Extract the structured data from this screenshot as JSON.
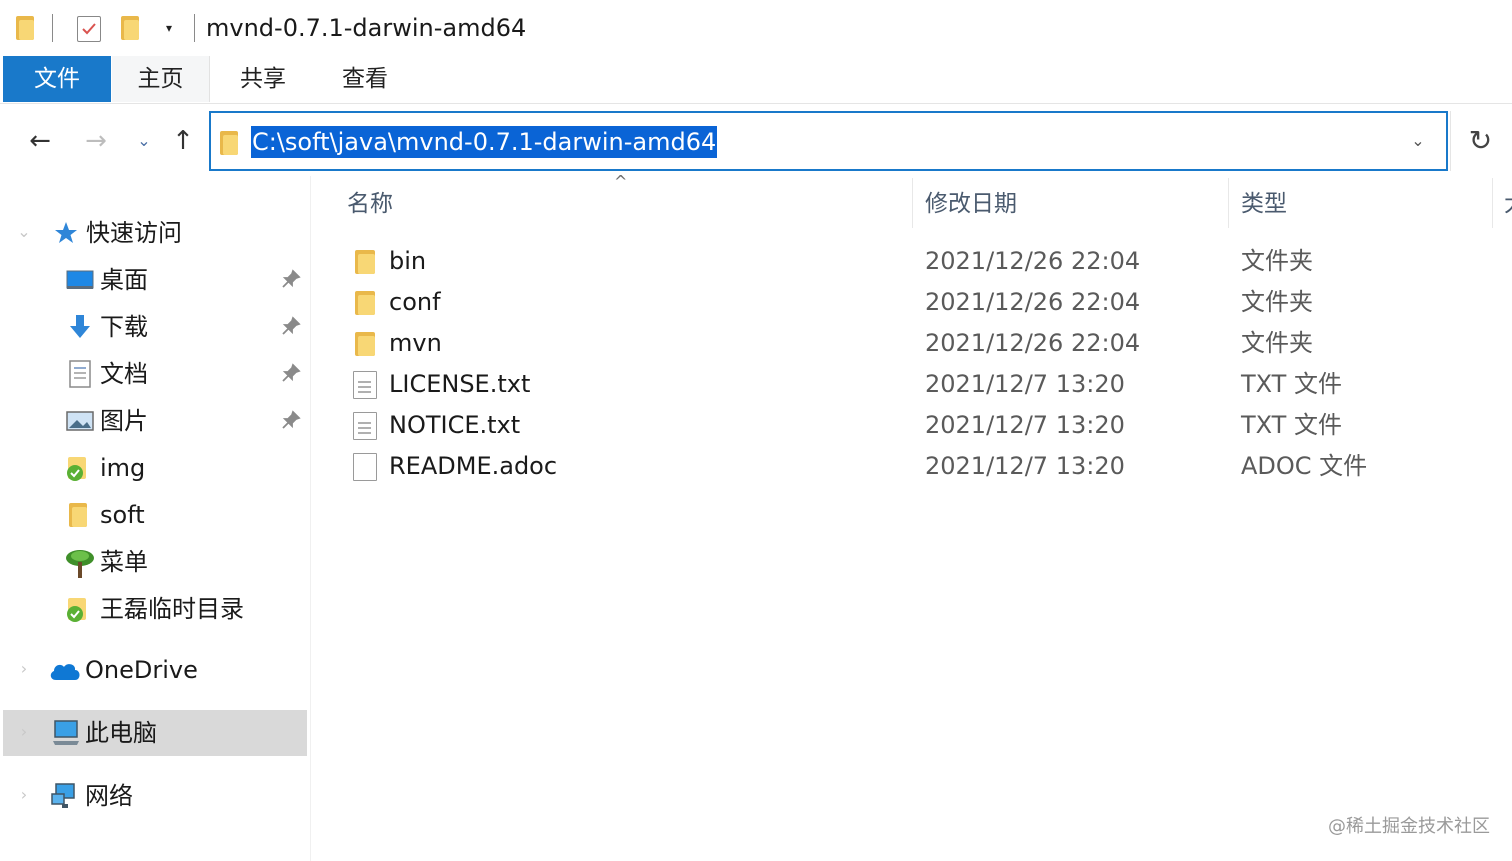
{
  "window": {
    "title": "mvnd-0.7.1-darwin-amd64"
  },
  "quick_access_toolbar": {
    "dropdown": "▾"
  },
  "ribbon": {
    "tabs": [
      {
        "label": "文件",
        "active": true
      },
      {
        "label": "主页"
      },
      {
        "label": "共享"
      },
      {
        "label": "查看"
      }
    ]
  },
  "nav": {
    "back": "←",
    "forward": "→",
    "recent": "⌄",
    "up": "↑",
    "address": "C:\\soft\\java\\mvnd-0.7.1-darwin-amd64",
    "address_dropdown": "⌄",
    "refresh": "↻"
  },
  "sidebar": {
    "quick_access": {
      "label": "快速访问",
      "chevron": "⌄"
    },
    "pinned": [
      {
        "label": "桌面",
        "icon": "desktop-icon",
        "pinned": true
      },
      {
        "label": "下载",
        "icon": "download-icon",
        "pinned": true
      },
      {
        "label": "文档",
        "icon": "documents-icon",
        "pinned": true
      },
      {
        "label": "图片",
        "icon": "pictures-icon",
        "pinned": true
      },
      {
        "label": "img",
        "icon": "folder-sync-icon"
      },
      {
        "label": "soft",
        "icon": "folder-icon"
      },
      {
        "label": "菜单",
        "icon": "tree-icon"
      },
      {
        "label": "王磊临时目录",
        "icon": "folder-sync-icon"
      }
    ],
    "onedrive": {
      "label": "OneDrive",
      "chevron": "›"
    },
    "this_pc": {
      "label": "此电脑",
      "chevron": "›",
      "selected": true
    },
    "network": {
      "label": "网络",
      "chevron": "›"
    }
  },
  "columns": {
    "name": "名称",
    "modified": "修改日期",
    "type": "类型",
    "overflow": "大"
  },
  "sort_indicator": "^",
  "files": [
    {
      "name": "bin",
      "modified": "2021/12/26 22:04",
      "type": "文件夹",
      "icon": "folder-icon"
    },
    {
      "name": "conf",
      "modified": "2021/12/26 22:04",
      "type": "文件夹",
      "icon": "folder-icon"
    },
    {
      "name": "mvn",
      "modified": "2021/12/26 22:04",
      "type": "文件夹",
      "icon": "folder-icon"
    },
    {
      "name": "LICENSE.txt",
      "modified": "2021/12/7 13:20",
      "type": "TXT 文件",
      "icon": "text-file-icon"
    },
    {
      "name": "NOTICE.txt",
      "modified": "2021/12/7 13:20",
      "type": "TXT 文件",
      "icon": "text-file-icon"
    },
    {
      "name": "README.adoc",
      "modified": "2021/12/7 13:20",
      "type": "ADOC 文件",
      "icon": "blank-file-icon"
    }
  ],
  "watermark": "@稀土掘金技术社区",
  "colors": {
    "accent": "#1979ca",
    "selection": "#0a64d6",
    "folder": "#f8d775",
    "sidebar_selected": "#d9d9d9"
  }
}
